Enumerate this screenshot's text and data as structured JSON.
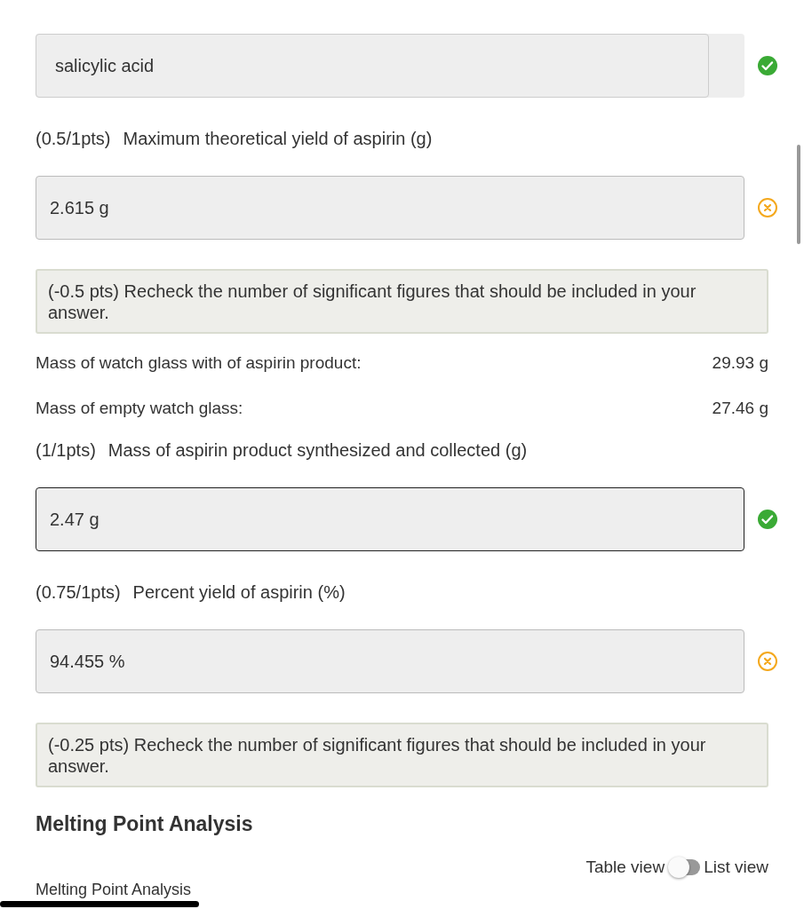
{
  "items": [
    {
      "kind": "answer",
      "value": "salicylic acid",
      "correct": true,
      "focused": false,
      "shaded": true
    },
    {
      "kind": "question",
      "points": "(0.5/1pts)",
      "text": "Maximum theoretical yield of aspirin (g)"
    },
    {
      "kind": "answer",
      "value": "2.615 g",
      "correct": false,
      "focused": false,
      "shaded": false
    },
    {
      "kind": "feedback",
      "text": "(-0.5 pts) Recheck the number of significant figures that should be included in your answer."
    },
    {
      "kind": "measurement",
      "label": "Mass of watch glass with of aspirin product:",
      "value": "29.93 g"
    },
    {
      "kind": "measurement",
      "label": "Mass of empty watch glass:",
      "value": "27.46 g"
    },
    {
      "kind": "question",
      "points": "(1/1pts)",
      "text": "Mass of aspirin product synthesized and collected (g)"
    },
    {
      "kind": "answer",
      "value": "2.47 g",
      "correct": true,
      "focused": true,
      "shaded": false
    },
    {
      "kind": "question",
      "points": "(0.75/1pts)",
      "text": "Percent yield of aspirin (%)"
    },
    {
      "kind": "answer",
      "value": "94.455 %",
      "correct": false,
      "focused": false,
      "shaded": false
    },
    {
      "kind": "feedback",
      "text": "(-0.25 pts) Recheck the number of significant figures that should be included in your answer."
    },
    {
      "kind": "heading",
      "text": "Melting Point Analysis"
    },
    {
      "kind": "toggle",
      "left": "Table view",
      "right": "List view",
      "on": false
    },
    {
      "kind": "cut",
      "text": "Melting Point Analysis"
    }
  ]
}
